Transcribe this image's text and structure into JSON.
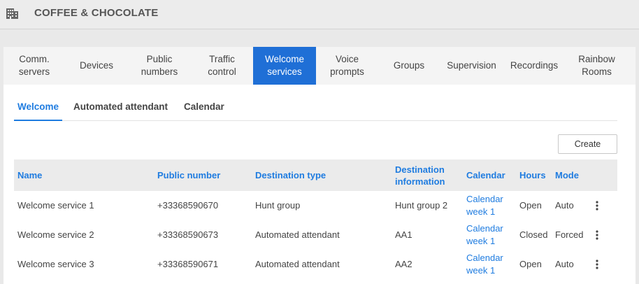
{
  "header": {
    "company": "COFFEE & CHOCOLATE",
    "icon": "building-icon"
  },
  "main_tabs": [
    {
      "label": "Comm.\nservers",
      "active": false
    },
    {
      "label": "Devices",
      "active": false
    },
    {
      "label": "Public\nnumbers",
      "active": false
    },
    {
      "label": "Traffic\ncontrol",
      "active": false
    },
    {
      "label": "Welcome\nservices",
      "active": true
    },
    {
      "label": "Voice\nprompts",
      "active": false
    },
    {
      "label": "Groups",
      "active": false
    },
    {
      "label": "Supervision",
      "active": false
    },
    {
      "label": "Recordings",
      "active": false
    },
    {
      "label": "Rainbow\nRooms",
      "active": false
    }
  ],
  "sub_tabs": [
    {
      "label": "Welcome",
      "active": true
    },
    {
      "label": "Automated attendant",
      "active": false
    },
    {
      "label": "Calendar",
      "active": false
    }
  ],
  "toolbar": {
    "create_label": "Create"
  },
  "table": {
    "columns": [
      "Name",
      "Public number",
      "Destination type",
      "Destination\ninformation",
      "Calendar",
      "Hours",
      "Mode"
    ],
    "rows": [
      {
        "name": "Welcome service 1",
        "public_number": "+33368590670",
        "destination_type": "Hunt group",
        "destination_info": "Hunt group 2",
        "calendar": "Calendar\nweek 1",
        "hours": "Open",
        "mode": "Auto"
      },
      {
        "name": "Welcome service 2",
        "public_number": "+33368590673",
        "destination_type": "Automated attendant",
        "destination_info": "AA1",
        "calendar": "Calendar\nweek 1",
        "hours": "Closed",
        "mode": "Forced"
      },
      {
        "name": "Welcome service 3",
        "public_number": "+33368590671",
        "destination_type": "Automated attendant",
        "destination_info": "AA2",
        "calendar": "Calendar\nweek 1",
        "hours": "Open",
        "mode": "Auto"
      }
    ]
  },
  "colors": {
    "accent": "#1f7ce0",
    "active_tab": "#1f6fd6"
  }
}
